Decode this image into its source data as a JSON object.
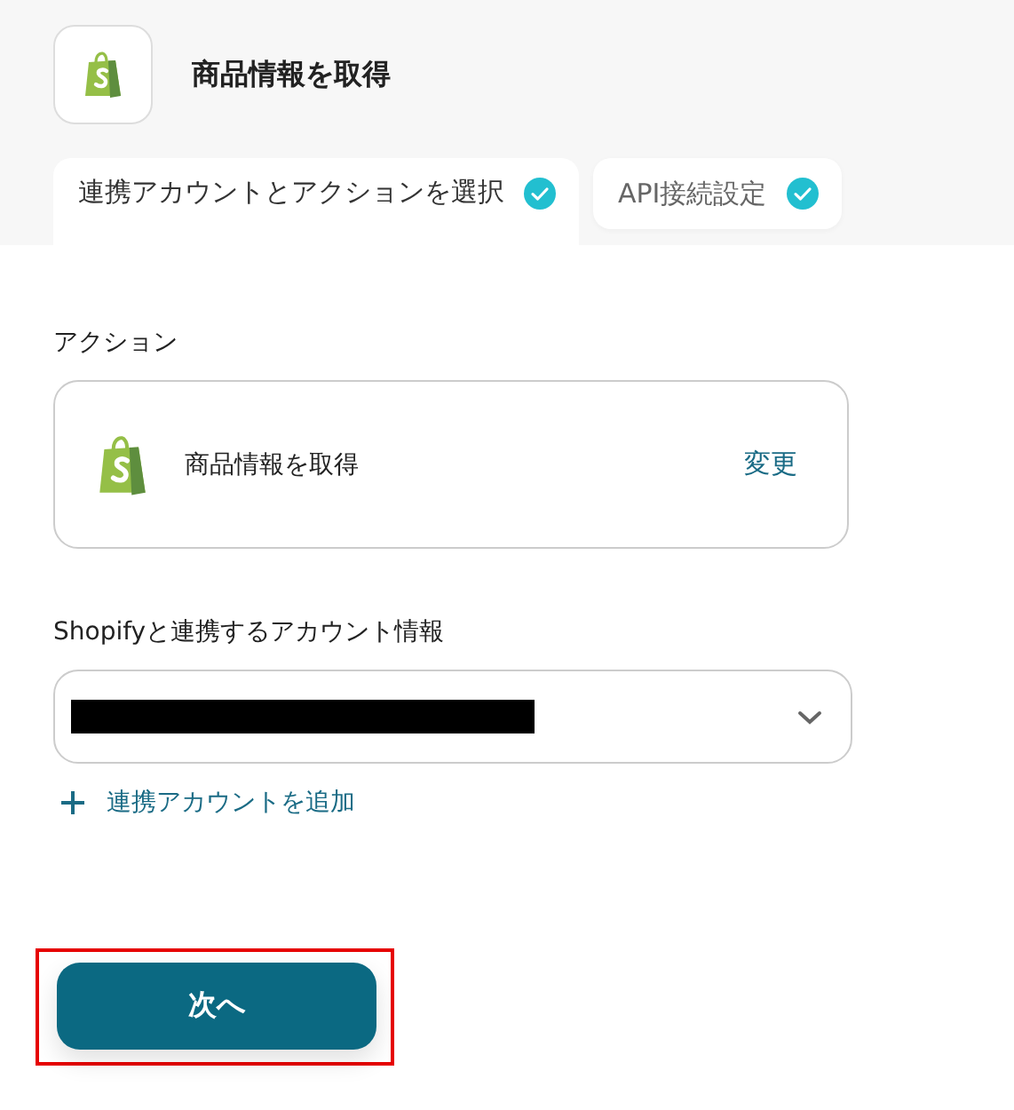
{
  "header": {
    "title": "商品情報を取得"
  },
  "tabs": [
    {
      "label": "連携アカウントとアクションを選択",
      "selected": true,
      "done": true
    },
    {
      "label": "API接続設定",
      "selected": false,
      "done": true
    }
  ],
  "action": {
    "label": "アクション",
    "name": "商品情報を取得",
    "change": "変更"
  },
  "account": {
    "label": "Shopifyと連携するアカウント情報",
    "redacted": true,
    "add": "連携アカウントを追加"
  },
  "next_button": {
    "label": "次へ",
    "highlighted": true
  }
}
